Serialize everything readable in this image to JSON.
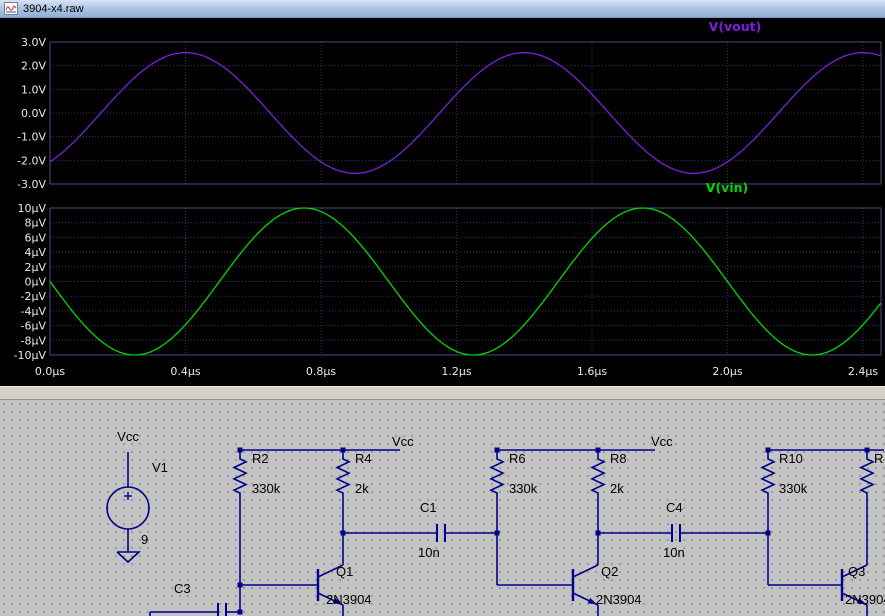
{
  "window": {
    "title": "3904-x4.raw"
  },
  "plot": {
    "bg": "#000000",
    "grid_color": "#34346e",
    "pane_border_color": "#4a4a82",
    "axis_text_color": "#e8e8e8",
    "x_ticks": [
      "0.0µs",
      "0.4µs",
      "0.8µs",
      "1.2µs",
      "1.6µs",
      "2.0µs",
      "2.4µs"
    ],
    "panes": [
      {
        "trace_label": "V(vout)",
        "trace_color": "#7a1fe0",
        "y_ticks": [
          "3.0V",
          "2.0V",
          "1.0V",
          "0.0V",
          "-1.0V",
          "-2.0V",
          "-3.0V"
        ]
      },
      {
        "trace_label": "V(vin)",
        "trace_color": "#00d800",
        "y_ticks": [
          "10µV",
          "8µV",
          "6µV",
          "4µV",
          "2µV",
          "0µV",
          "-2µV",
          "-4µV",
          "-6µV",
          "-8µV",
          "-10µV"
        ]
      }
    ]
  },
  "chart_data": [
    {
      "type": "line",
      "name": "V(vout)",
      "color": "#7a1fe0",
      "x_unit": "µs",
      "x_range_us": [
        0,
        2.45
      ],
      "y_unit": "V",
      "ylim": [
        -3,
        3
      ],
      "signal": {
        "shape": "sine",
        "amplitude": 2.55,
        "offset": 0,
        "period_us": 1.0,
        "rising_zero_cross_us": 0.15
      },
      "peak": 2.5,
      "trough": -2.6,
      "frequency_MHz": 1
    },
    {
      "type": "line",
      "name": "V(vin)",
      "color": "#00d800",
      "x_unit": "µs",
      "x_range_us": [
        0,
        2.45
      ],
      "y_unit": "µV",
      "ylim": [
        -10,
        10
      ],
      "signal": {
        "shape": "sine",
        "amplitude": 10,
        "offset": 0,
        "period_us": 1.0,
        "rising_zero_cross_us": 0.5
      },
      "peak": 10,
      "trough": -10,
      "frequency_MHz": 1
    }
  ],
  "schematic": {
    "wire_color": "#00008c",
    "text_color": "#000000",
    "labels": [
      {
        "id": "vcc-v1",
        "text": "Vcc"
      },
      {
        "id": "v1-name",
        "text": "V1"
      },
      {
        "id": "v1-value",
        "text": "9"
      },
      {
        "id": "r2-name",
        "text": "R2"
      },
      {
        "id": "r2-value",
        "text": "330k"
      },
      {
        "id": "r4-name",
        "text": "R4"
      },
      {
        "id": "r4-value",
        "text": "2k"
      },
      {
        "id": "vcc-flag-1",
        "text": "Vcc"
      },
      {
        "id": "r6-name",
        "text": "R6"
      },
      {
        "id": "r6-value",
        "text": "330k"
      },
      {
        "id": "r8-name",
        "text": "R8"
      },
      {
        "id": "r8-value",
        "text": "2k"
      },
      {
        "id": "vcc-flag-2",
        "text": "Vcc"
      },
      {
        "id": "r10-name",
        "text": "R10"
      },
      {
        "id": "r10-value",
        "text": "330k"
      },
      {
        "id": "r-right-name",
        "text": "R"
      },
      {
        "id": "c1-name",
        "text": "C1"
      },
      {
        "id": "c1-value",
        "text": "10n"
      },
      {
        "id": "c4-name",
        "text": "C4"
      },
      {
        "id": "c4-value",
        "text": "10n"
      },
      {
        "id": "c3-name",
        "text": "C3"
      },
      {
        "id": "q1-name",
        "text": "Q1"
      },
      {
        "id": "q1-value",
        "text": "2N3904"
      },
      {
        "id": "q2-name",
        "text": "Q2"
      },
      {
        "id": "q2-value",
        "text": "2N3904"
      },
      {
        "id": "q3-name",
        "text": "Q3"
      },
      {
        "id": "q3-value",
        "text": "2N3904"
      }
    ]
  }
}
